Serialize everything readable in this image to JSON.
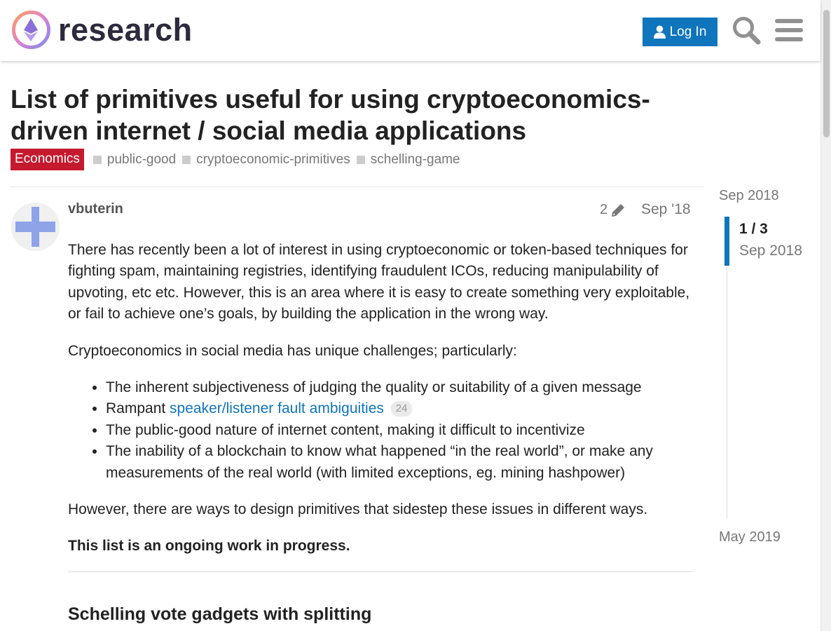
{
  "header": {
    "site_name": "research",
    "login_label": "Log In",
    "icons": [
      "logo-icon",
      "user-icon",
      "search-icon",
      "hamburger-menu-icon"
    ]
  },
  "topic": {
    "title": "List of primitives useful for using cryptoeconomics-driven internet / social media applications",
    "category": "Economics",
    "category_color": "#c5192d",
    "tags": [
      "public-good",
      "cryptoeconomic-primitives",
      "schelling-game"
    ]
  },
  "post": {
    "username": "vbuterin",
    "edit_count": "2",
    "date": "Sep '18",
    "paragraphs": [
      "There has recently been a lot of interest in using cryptoeconomic or token-based techniques for fighting spam, maintaining registries, identifying fraudulent ICOs, reducing manipulability of upvoting, etc etc. However, this is an area where it is easy to create something very exploitable, or fail to achieve one’s goals, by building the application in the wrong way.",
      "Cryptoeconomics in social media has unique challenges; particularly:"
    ],
    "bullets": {
      "b1": "The inherent subjectiveness of judging the quality or suitability of a given message",
      "b2_prefix": "Rampant ",
      "b2_link": "speaker/listener fault ambiguities",
      "b2_count": "24",
      "b3": "The public-good nature of internet content, making it difficult to incentivize",
      "b4": "The inability of a blockchain to know what happened “in the real world”, or make any measurements of the real world (with limited exceptions, eg. mining hashpower)"
    },
    "closing": "However, there are ways to design primitives that sidestep these issues in different ways.",
    "bold_note": "This list is an ongoing work in progress.",
    "section_heading": "Schelling vote gadgets with splitting"
  },
  "timeline": {
    "start": "Sep 2018",
    "position": "1 / 3",
    "position_date": "Sep 2018",
    "end": "May 2019",
    "accent": "#0f75bc"
  }
}
